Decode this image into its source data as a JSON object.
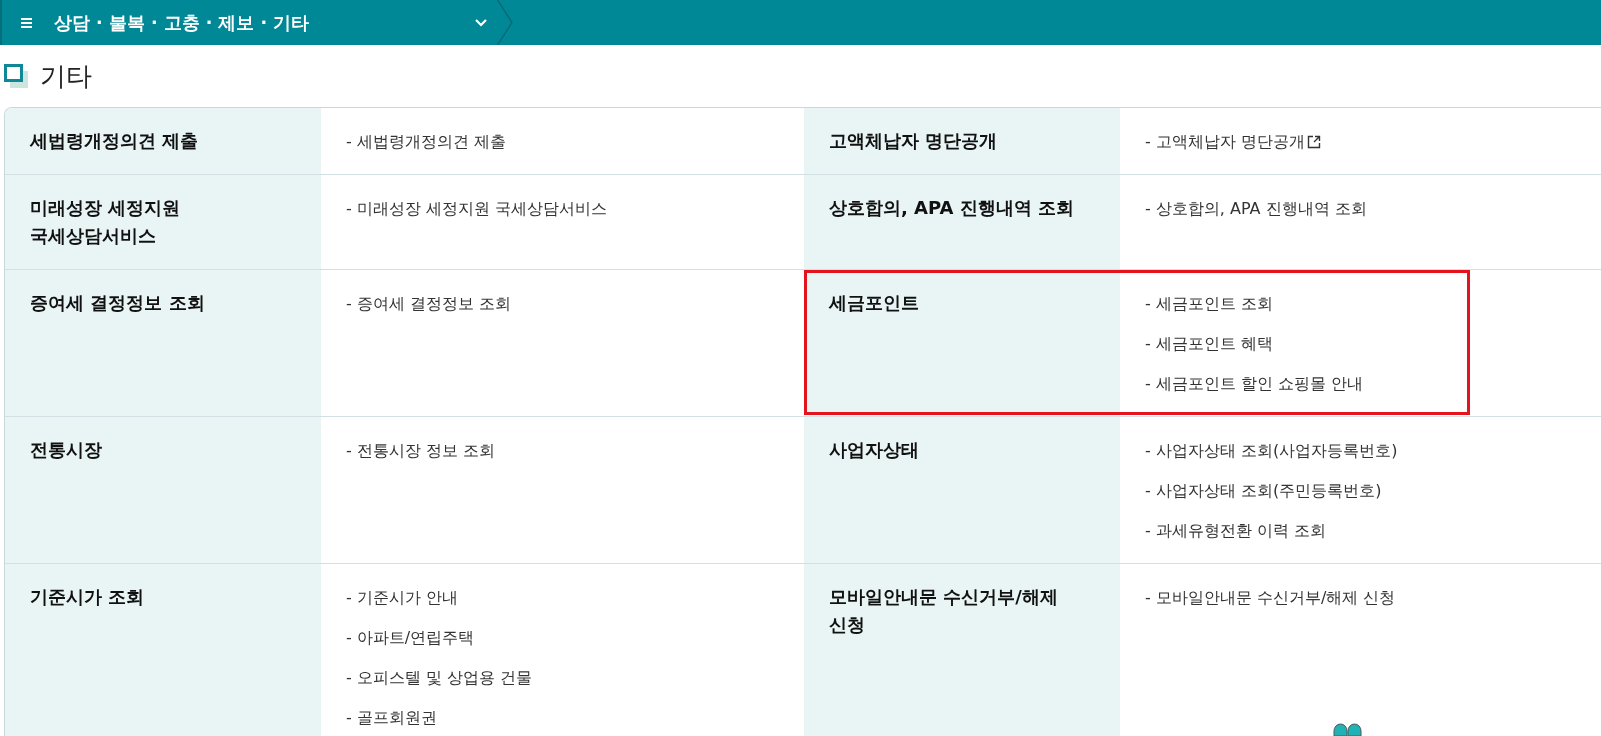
{
  "menu_bar": {
    "label": "상담 · 불복 · 고충 · 제보 · 기타"
  },
  "page_title": "기타",
  "rows": [
    {
      "cells": [
        {
          "title": "세법령개정의견 제출",
          "highlighted": false,
          "links": [
            {
              "text": "- 세법령개정의견 제출",
              "external": false
            }
          ]
        },
        {
          "title": "고액체납자 명단공개",
          "highlighted": false,
          "links": [
            {
              "text": "- 고액체납자 명단공개",
              "external": true
            }
          ]
        }
      ]
    },
    {
      "cells": [
        {
          "title": "미래성장 세정지원 국세상담서비스",
          "highlighted": false,
          "links": [
            {
              "text": "- 미래성장 세정지원 국세상담서비스",
              "external": false
            }
          ]
        },
        {
          "title": "상호합의, APA 진행내역 조회",
          "highlighted": false,
          "links": [
            {
              "text": "- 상호합의, APA 진행내역 조회",
              "external": false
            }
          ]
        }
      ]
    },
    {
      "cells": [
        {
          "title": "증여세 결정정보 조회",
          "highlighted": false,
          "links": [
            {
              "text": "- 증여세 결정정보 조회",
              "external": false
            }
          ]
        },
        {
          "title": "세금포인트",
          "highlighted": true,
          "links": [
            {
              "text": "- 세금포인트 조회",
              "external": false
            },
            {
              "text": "- 세금포인트 혜택",
              "external": false
            },
            {
              "text": "- 세금포인트 할인 쇼핑몰 안내",
              "external": false
            }
          ]
        }
      ]
    },
    {
      "cells": [
        {
          "title": "전통시장",
          "highlighted": false,
          "links": [
            {
              "text": "- 전통시장 정보 조회",
              "external": false
            }
          ]
        },
        {
          "title": "사업자상태",
          "highlighted": false,
          "links": [
            {
              "text": "- 사업자상태 조회(사업자등록번호)",
              "external": false
            },
            {
              "text": "- 사업자상태 조회(주민등록번호)",
              "external": false
            },
            {
              "text": "- 과세유형전환 이력 조회",
              "external": false
            }
          ]
        }
      ]
    },
    {
      "cells": [
        {
          "title": "기준시가 조회",
          "highlighted": false,
          "links": [
            {
              "text": "- 기준시가 안내",
              "external": false
            },
            {
              "text": "- 아파트/연립주택",
              "external": false
            },
            {
              "text": "- 오피스텔 및 상업용 건물",
              "external": false
            },
            {
              "text": "- 골프회원권",
              "external": false
            }
          ]
        },
        {
          "title": "모바일안내문 수신거부/해제 신청",
          "highlighted": false,
          "links": [
            {
              "text": "- 모바일안내문 수신거부/해제 신청",
              "external": false
            }
          ]
        }
      ]
    }
  ]
}
